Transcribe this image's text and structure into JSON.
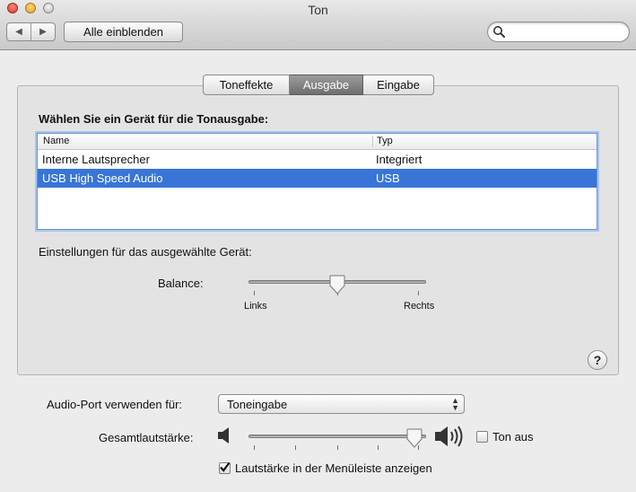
{
  "window": {
    "title": "Ton"
  },
  "toolbar": {
    "back_glyph": "◀",
    "forward_glyph": "▶",
    "show_all_label": "Alle einblenden",
    "search_value": ""
  },
  "tabs": [
    {
      "label": "Toneffekte",
      "active": false
    },
    {
      "label": "Ausgabe",
      "active": true
    },
    {
      "label": "Eingabe",
      "active": false
    }
  ],
  "output": {
    "heading": "Wählen Sie ein Gerät für die Tonausgabe:",
    "columns": [
      "Name",
      "Typ"
    ],
    "devices": [
      {
        "name": "Interne Lautsprecher",
        "type": "Integriert",
        "selected": false
      },
      {
        "name": "USB High Speed Audio",
        "type": "USB",
        "selected": true
      }
    ],
    "settings_label": "Einstellungen für das ausgewählte Gerät:",
    "balance": {
      "label": "Balance:",
      "left_label": "Links",
      "right_label": "Rechts",
      "value": 0.5
    }
  },
  "help": {
    "glyph": "?"
  },
  "bottom": {
    "audio_port_label": "Audio-Port verwenden für:",
    "audio_port_value": "Toneingabe",
    "volume_label": "Gesamtlautstärke:",
    "volume_value": 0.97,
    "mute_label": "Ton aus",
    "mute_checked": false,
    "menubar_label": "Lautstärke in der Menüleiste anzeigen",
    "menubar_checked": true
  },
  "colors": {
    "selection": "#3875d7",
    "focus_ring": "#6d93d3"
  }
}
